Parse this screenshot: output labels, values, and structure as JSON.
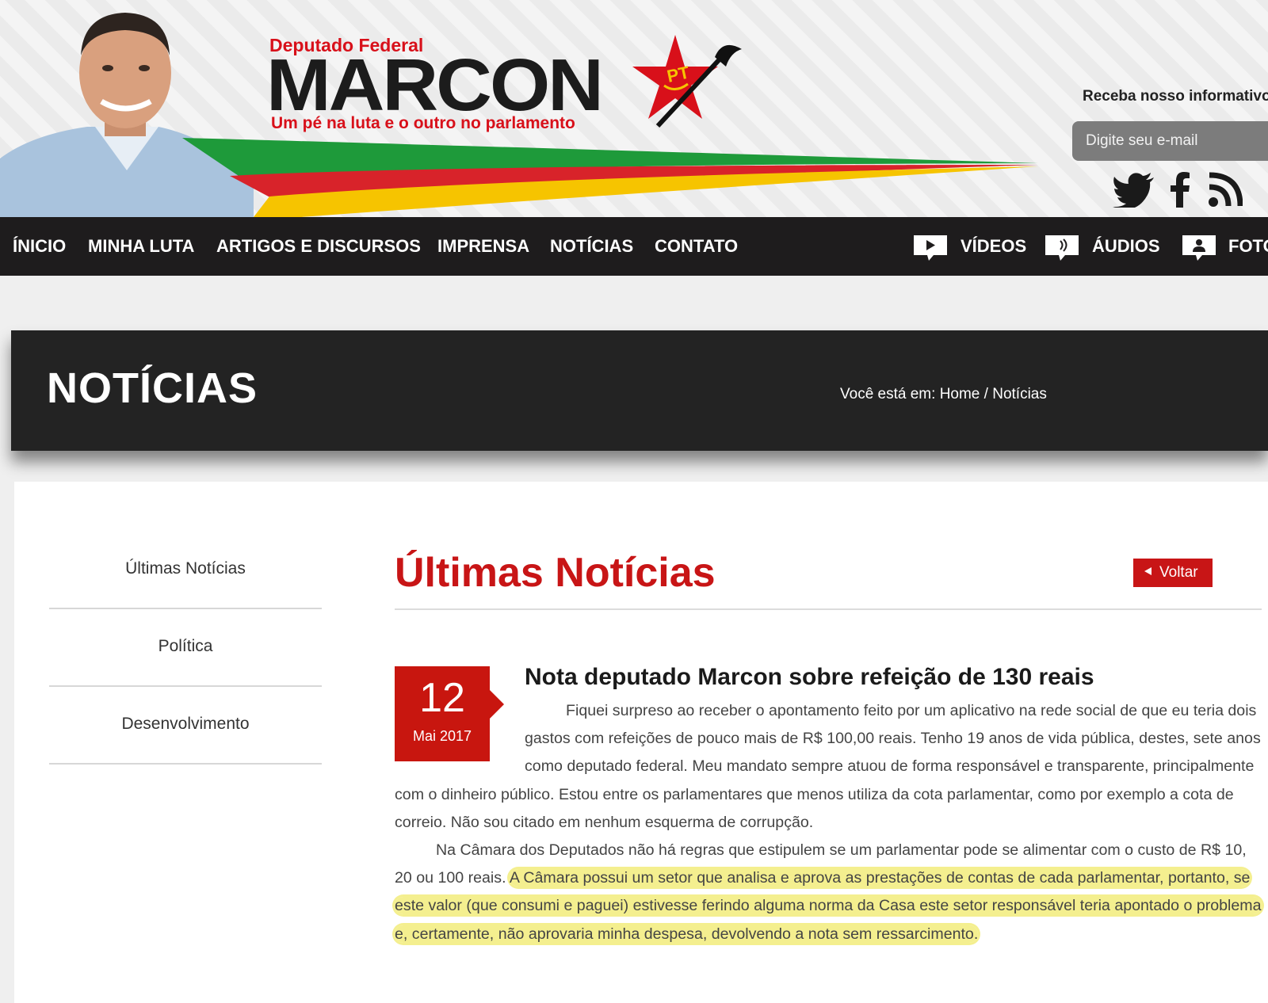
{
  "header": {
    "logo_top": "Deputado Federal",
    "logo_name": "MARCON",
    "logo_slogan": "Um pé na luta e o outro no parlamento",
    "party_badge": "PT",
    "newsletter_label": "Receba nosso informativo",
    "email_placeholder": "Digite seu e-mail",
    "social_icons": [
      "twitter-icon",
      "facebook-icon",
      "rss-icon"
    ]
  },
  "nav": {
    "items": [
      "ÍNICIO",
      "MINHA LUTA",
      "ARTIGOS E DISCURSOS",
      "IMPRENSA",
      "NOTÍCIAS",
      "CONTATO"
    ],
    "media": [
      {
        "label": "VÍDEOS",
        "icon": "play-icon"
      },
      {
        "label": "ÁUDIOS",
        "icon": "speaker-icon"
      },
      {
        "label": "FOTOS",
        "icon": "person-icon"
      }
    ]
  },
  "title_band": {
    "heading": "NOTÍCIAS",
    "breadcrumb_prefix": "Você está em: ",
    "breadcrumb_home": "Home",
    "breadcrumb_sep": " / ",
    "breadcrumb_current": "Notícias"
  },
  "sidebar": {
    "items": [
      "Últimas Notícias",
      "Política",
      "Desenvolvimento"
    ]
  },
  "main": {
    "heading": "Últimas Notícias",
    "back_label": "Voltar"
  },
  "article": {
    "day": "12",
    "month_year": "Mai 2017",
    "title": "Nota deputado Marcon sobre refeição de 130 reais",
    "para1": "Fiquei surpreso ao receber o apontamento feito por um aplicativo na rede social de que eu teria dois gastos com refeições de pouco mais de R$ 100,00 reais. Tenho 19 anos de vida pública, destes, sete anos como deputado federal. Meu mandato sempre atuou de forma responsável e transparente, principalmente com o dinheiro público. Estou entre os parlamentares que menos utiliza da cota parlamentar, como por exemplo a cota de correio. Não sou citado em nenhum esquerma de corrupção.",
    "para2_plain": "Na Câmara dos Deputados não há regras que estipulem se um parlamentar pode se alimentar com o custo de R$ 10, 20 ou 100 reais.",
    "para2_highlight": "A Câmara possui um setor que analisa e aprova as prestações de contas de cada parlamentar, portanto, se este valor (que consumi e paguei) estivesse ferindo alguma norma da Casa este setor responsável teria apontado o problema e, certamente, não aprovaria minha despesa, devolvendo a nota sem ressarcimento.",
    "highlight_color": "#f4ef8f"
  },
  "colors": {
    "brand_red": "#c81516",
    "nav_bg": "#1e1c1d",
    "flag_green": "#1e9a3a",
    "flag_red": "#d8232a",
    "flag_yellow": "#f6c400"
  }
}
